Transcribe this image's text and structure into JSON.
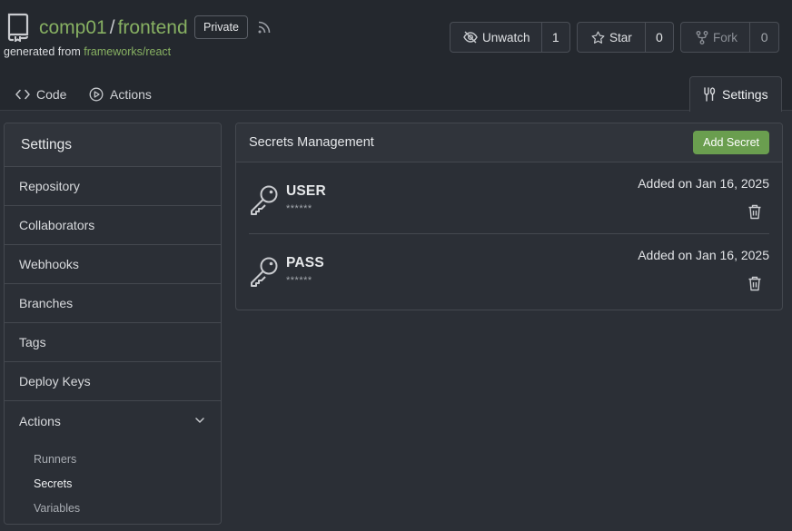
{
  "repo": {
    "owner": "comp01",
    "separator": "/",
    "name": "frontend",
    "visibility": "Private",
    "generated_prefix": "generated from",
    "template_link": "frameworks/react"
  },
  "actions_bar": {
    "unwatch": {
      "label": "Unwatch",
      "count": "1",
      "icon": "eye-slash-icon"
    },
    "star": {
      "label": "Star",
      "count": "0",
      "icon": "star-icon"
    },
    "fork": {
      "label": "Fork",
      "count": "0",
      "icon": "fork-icon"
    }
  },
  "tabs": [
    {
      "label": "Code",
      "icon": "code-icon"
    },
    {
      "label": "Actions",
      "icon": "play-circle-icon"
    },
    {
      "label": "Settings",
      "icon": "tools-icon",
      "active": true
    }
  ],
  "sidebar": {
    "title": "Settings",
    "items": [
      "Repository",
      "Collaborators",
      "Webhooks",
      "Branches",
      "Tags",
      "Deploy Keys",
      "Actions"
    ],
    "actions_sub": [
      "Runners",
      "Secrets",
      "Variables"
    ],
    "active_sub": "Secrets"
  },
  "secrets_panel": {
    "title": "Secrets Management",
    "add_button": "Add Secret",
    "rows": [
      {
        "name": "USER",
        "mask": "******",
        "added": "Added on Jan 16, 2025"
      },
      {
        "name": "PASS",
        "mask": "******",
        "added": "Added on Jan 16, 2025"
      }
    ]
  },
  "colors": {
    "accent_green": "#87b062",
    "button_green": "#6a9e4f",
    "background": "#2b2f36",
    "header_bg": "#24282e"
  }
}
